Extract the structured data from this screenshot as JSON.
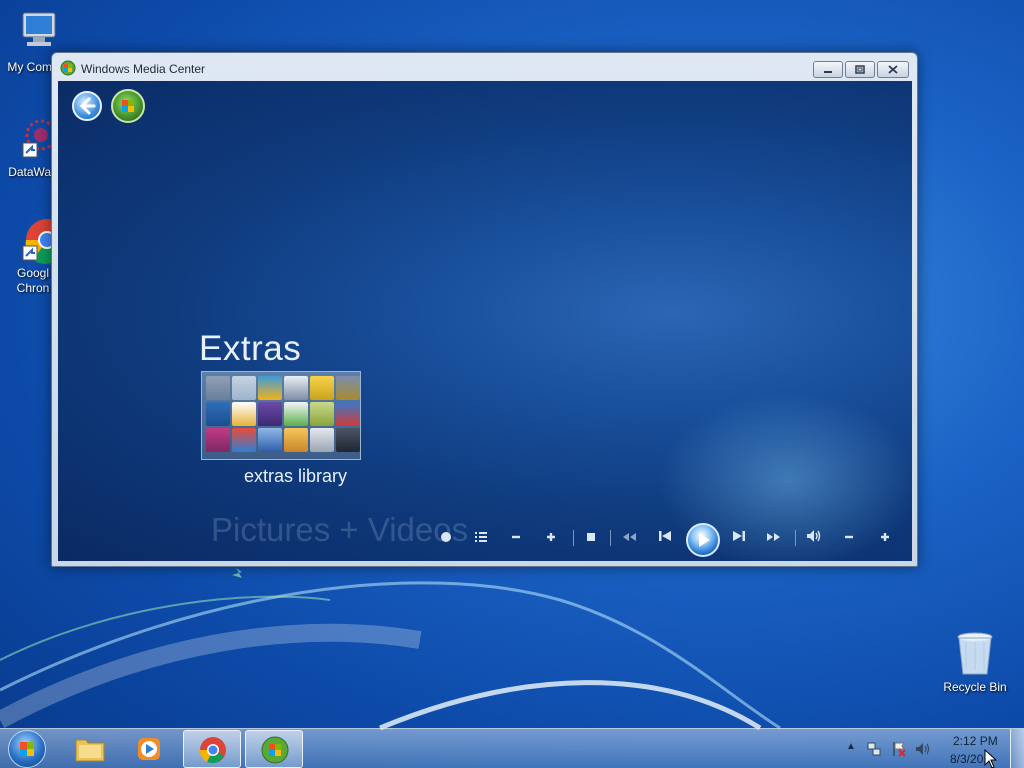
{
  "desktop": {
    "icons": [
      {
        "label": "My Comp",
        "icon": "computer-icon"
      },
      {
        "label": "DataWag",
        "icon": "datawag-icon"
      },
      {
        "label": "Googl Chron",
        "icon": "chrome-icon"
      },
      {
        "label": "Recycle Bin",
        "icon": "recycle-bin-icon"
      }
    ]
  },
  "window": {
    "title": "Windows Media Center",
    "icon": "media-center-icon",
    "buttons": {
      "minimize": "minimize-icon",
      "maximize": "restore-icon",
      "close": "close-icon"
    }
  },
  "media_center": {
    "section_title": "Extras",
    "tile_label": "extras library",
    "next_section_ghost": "Pictures + Videos",
    "controls": [
      "record",
      "menu",
      "channel-down",
      "channel-up",
      "stop",
      "rewind",
      "previous",
      "play",
      "next",
      "fast-forward",
      "volume",
      "volume-down",
      "volume-up"
    ]
  },
  "taskbar": {
    "items": [
      {
        "name": "windows-explorer",
        "active": false
      },
      {
        "name": "windows-media-player",
        "active": false
      },
      {
        "name": "google-chrome",
        "active": true
      },
      {
        "name": "windows-media-center",
        "active": true
      }
    ],
    "clock": {
      "time": "2:12 PM",
      "date": "8/3/20"
    }
  },
  "colors": {
    "desktop_blue": "#1b63c6",
    "mc_background": "#0f3a7c",
    "mc_text": "#e8f1fb",
    "play_accent": "#1f73cf"
  }
}
